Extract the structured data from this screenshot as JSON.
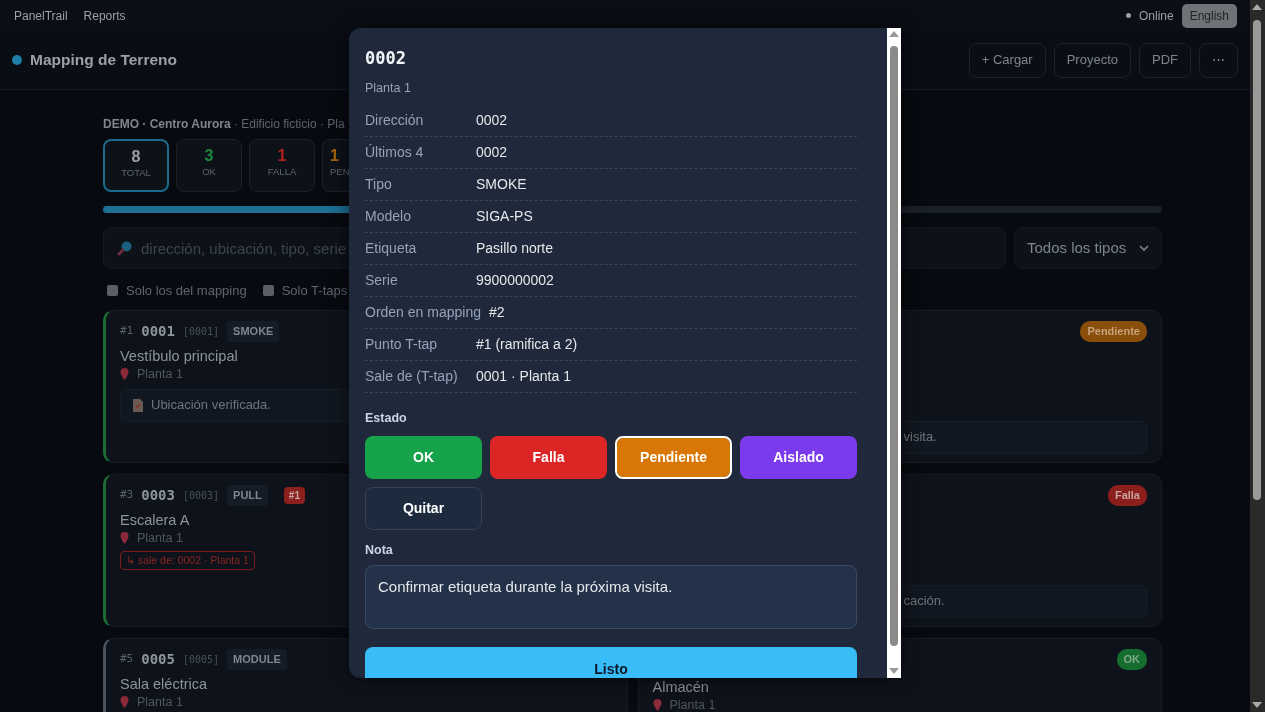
{
  "topnav": {
    "brand": "PanelTrail",
    "links": [
      "Reports"
    ],
    "status": "Online",
    "language_button": "English"
  },
  "header": {
    "title": "Mapping de Terreno",
    "actions": [
      "+ Cargar",
      "Proyecto",
      "PDF",
      "⋯"
    ]
  },
  "project_meta": "**DEMO · Centro Aurora** · Edificio ficticio · Pla",
  "stats": [
    {
      "value": "8",
      "label": "TOTAL",
      "color": "#9aa0a6",
      "selected": true
    },
    {
      "value": "3",
      "label": "OK",
      "color": "#1f8a3e",
      "selected": false
    },
    {
      "value": "1",
      "label": "FALLA",
      "color": "#b3201f",
      "selected": false
    },
    {
      "value": "1",
      "label": "PEN",
      "color": "#a8640c",
      "selected": false
    }
  ],
  "progress": {
    "level": 0.375
  },
  "search": {
    "placeholder": "dirección, ubicación, tipo, serie"
  },
  "type_filter": {
    "value": "Todos los tipos"
  },
  "filters": [
    {
      "label": "Solo los del mapping",
      "checked": false
    },
    {
      "label": "Solo T-taps",
      "checked": false
    }
  ],
  "left_cards": [
    {
      "order": "#1",
      "address": "0001",
      "code": "[0001]",
      "type": "SMOKE",
      "location": "Vestíbulo principal",
      "floor": "Planta 1",
      "note": "Ubicación verificada.",
      "color": "#1b6b32"
    },
    {
      "order": "#3",
      "address": "0003",
      "code": "[0003]",
      "type": "PULL",
      "tap": "#1",
      "location": "Escalera A",
      "floor": "Planta 1",
      "branch": "↳ sale de: 0002 · Planta 1",
      "color": "#1b6b32"
    },
    {
      "order": "#5",
      "address": "0005",
      "code": "[0005]",
      "type": "MODULE",
      "location": "Sala eléctrica",
      "floor": "Planta 1",
      "color": "#4a5260"
    }
  ],
  "right_cards": [
    {
      "status": "Pendiente",
      "kind": "pending",
      "note": "visita."
    },
    {
      "status": "Falla",
      "kind": "fail",
      "note": "cación."
    },
    {
      "status": "OK",
      "kind": "ok",
      "location": "Almacén",
      "floor": "Planta 1"
    }
  ],
  "modal": {
    "title": "0002",
    "subtitle": "Planta 1",
    "fields": [
      {
        "label": "Dirección",
        "value": "0002"
      },
      {
        "label": "Últimos 4",
        "value": "0002"
      },
      {
        "label": "Tipo",
        "value": "SMOKE"
      },
      {
        "label": "Modelo",
        "value": "SIGA-PS"
      },
      {
        "label": "Etiqueta",
        "value": "Pasillo norte"
      },
      {
        "label": "Serie",
        "value": "9900000002"
      },
      {
        "label": "Orden en mapping",
        "value": "#2"
      },
      {
        "label": "Punto T-tap",
        "value": "#1 (ramifica a 2)"
      },
      {
        "label": "Sale de (T-tap)",
        "value": "0001 · Planta 1"
      }
    ],
    "state_label": "Estado",
    "state_buttons": [
      {
        "label": "OK",
        "kind": "ok",
        "selected": false
      },
      {
        "label": "Falla",
        "kind": "fail",
        "selected": false
      },
      {
        "label": "Pendiente",
        "kind": "pending",
        "selected": true
      },
      {
        "label": "Aislado",
        "kind": "isolated",
        "selected": false
      },
      {
        "label": "Quitar",
        "kind": "clear",
        "selected": false
      }
    ],
    "note_label": "Nota",
    "note": "Confirmar etiqueta durante la próxima visita.",
    "done_button": "Listo"
  }
}
